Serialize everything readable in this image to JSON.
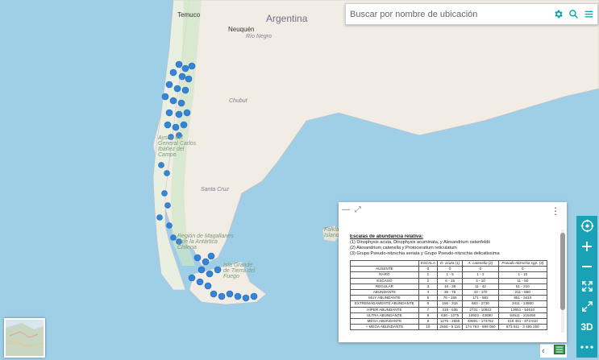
{
  "search": {
    "placeholder": "Buscar por nombre de ubicación"
  },
  "toolbar": {
    "threeD_label": "3D"
  },
  "map_labels": {
    "temuco": "Temuco",
    "argentina": "Argentina",
    "neuquen": "Neuquén",
    "rio_negro": "Río Negro",
    "chubut": "Chubut",
    "santa_cruz": "Santa Cruz",
    "aysen": "Aysén del General Carlos Ibáñez del Campo",
    "magallanes": "Región de Magallanes y de la Antártica Chilena",
    "tierra_fuego": "Isla Grande de Tierra del Fuego",
    "falkland": "Falkland Islands"
  },
  "legend": {
    "title": "Escalas de abundancia relativa:",
    "lines": [
      "(1) Dinophysis acuta, Dinophysis acuminata, y Alexandrium ostenfeldii",
      "(2) Alexandrium catenella y Protoceratium reticulatum",
      "(3) Grupo Pseudo-nitzschia seriata y Grupo Pseudo-nitzschia delicatissima"
    ],
    "headers": [
      "ESCALA",
      "D. acuta (1)",
      "A. catenella (2)",
      "Pseudo-nitzschia spp. (3)"
    ],
    "rows": [
      [
        "AUSENTE",
        "0",
        "0",
        "0",
        "0"
      ],
      [
        "RARO",
        "1",
        "1 - 5",
        "1 - 2",
        "1 - 10"
      ],
      [
        "ESCASO",
        "2",
        "6 - 15",
        "3 - 10",
        "11 - 50"
      ],
      [
        "REGULAR",
        "3",
        "16 - 35",
        "11 - 42",
        "51 - 210"
      ],
      [
        "ABUNDANTE",
        "4",
        "36 - 75",
        "43 - 170",
        "211 - 850"
      ],
      [
        "MUY ABUNDANTE",
        "5",
        "76 - 155",
        "171 - 682",
        "851 - 3410"
      ],
      [
        "EXTREMADAMENTE ABUNDANTE",
        "6",
        "156 - 315",
        "683 - 2730",
        "3411 - 13650"
      ],
      [
        "HIPER ABUNDANTE",
        "7",
        "316 - 635",
        "2731 - 10922",
        "13651 - 54610"
      ],
      [
        "ULTRA ABUNDANTE",
        "8",
        "636 - 1275",
        "10923 - 43690",
        "54611 - 218450"
      ],
      [
        "MEGA ABUNDANTE",
        "9",
        "1276 - 2555",
        "43691 - 174762",
        "218 451 - 873 810"
      ],
      [
        "+ MEGA ABUNDANTE",
        "10",
        "2556 - 5 115",
        "174 763 - 699 050",
        "873 811 - 3 495 250"
      ]
    ]
  },
  "colors": {
    "accent": "#1aa1b6",
    "water": "#9fcfe6",
    "land": "#f1ede4",
    "marker": "#2b7fd9"
  },
  "icons": [
    "gear-icon",
    "search-icon",
    "menu-icon",
    "compass-icon",
    "zoom-in-icon",
    "zoom-out-icon",
    "fullscreen-icon",
    "split-icon",
    "more-icon",
    "collapse-icon",
    "expand-icon",
    "vertical-dots-icon",
    "back-icon",
    "layers-icon"
  ]
}
